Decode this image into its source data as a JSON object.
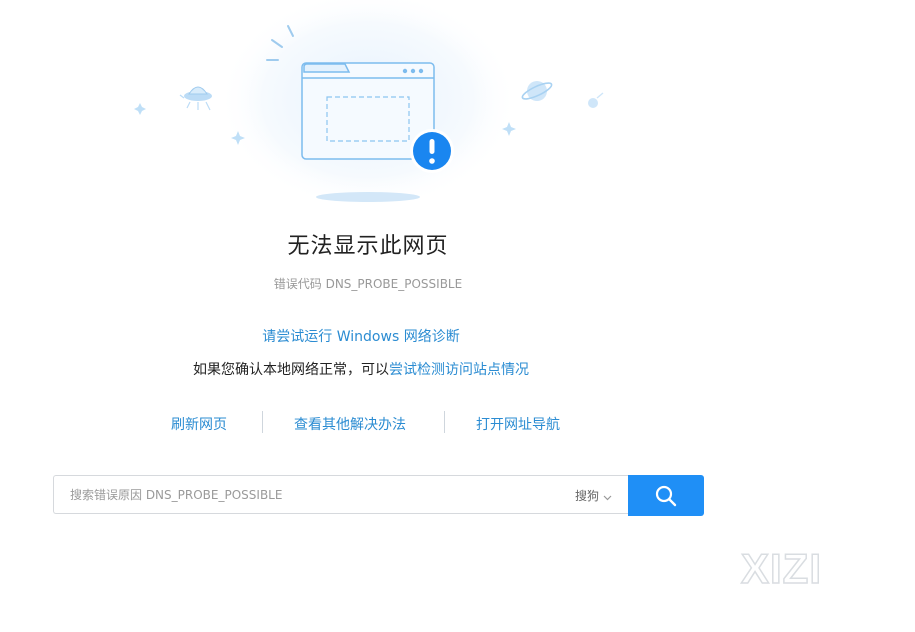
{
  "error": {
    "title": "无法显示此网页",
    "code_label": "错误代码 DNS_PROBE_POSSIBLE"
  },
  "suggestions": {
    "diagnose_link": "请尝试运行 Windows 网络诊断",
    "confirm_prefix": "如果您确认本地网络正常，可以",
    "confirm_link": "尝试检测访问站点情况"
  },
  "actions": {
    "refresh": "刷新网页",
    "other_solutions": "查看其他解决办法",
    "open_nav": "打开网址导航"
  },
  "search": {
    "placeholder": "搜索错误原因 DNS_PROBE_POSSIBLE",
    "engine": "搜狗",
    "button_icon": "search-icon"
  },
  "watermark": {
    "text": "XIZI"
  },
  "colors": {
    "link": "#2b8cd2",
    "accent": "#1f8ff6",
    "alert": "#1a86f0"
  }
}
